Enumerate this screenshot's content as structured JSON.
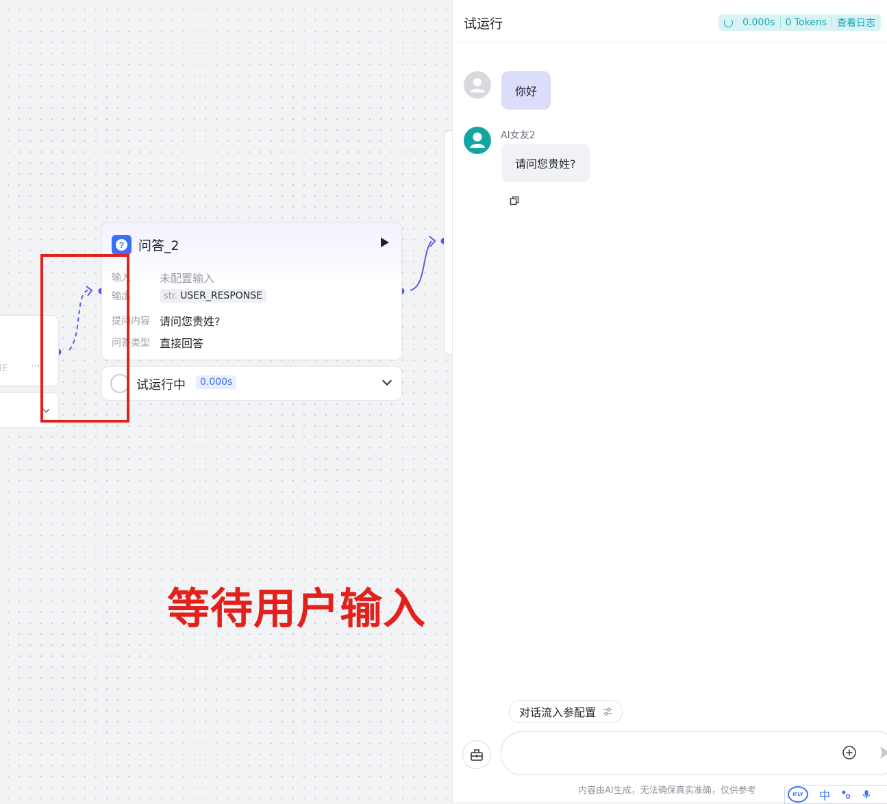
{
  "canvas": {
    "node": {
      "title": "问答_2",
      "rows": [
        {
          "key": "输入",
          "value": "未配置输入"
        },
        {
          "key": "输出",
          "type": "str.",
          "value": "USER_RESPONSE"
        },
        {
          "key": "提问内容",
          "value": "请问您贵姓?"
        },
        {
          "key": "问答类型",
          "value": "直接回答"
        }
      ]
    },
    "status": {
      "label": "试运行中",
      "time": "0.000s"
    },
    "left_node": {
      "fragment": "IE",
      "more": "···"
    },
    "annotation": "等待用户输入",
    "colors": {
      "edge": "#5a5ae6",
      "annotation": "#e3201b",
      "node_icon": "#3b6ff6"
    }
  },
  "panel": {
    "title": "试运行",
    "stats": {
      "time": "0.000s",
      "tokens": "0 Tokens",
      "log": "查看日志"
    },
    "messages": [
      {
        "role": "user",
        "text": "你好"
      },
      {
        "role": "bot",
        "name": "AI女友2",
        "text": "请问您贵姓?"
      }
    ],
    "param_config": "对话流入参配置",
    "input_value": "",
    "disclaimer": "内容由AI生成，无法确保真实准确，仅供参考",
    "ime": {
      "logo": "iFLY",
      "lang": "中"
    }
  }
}
